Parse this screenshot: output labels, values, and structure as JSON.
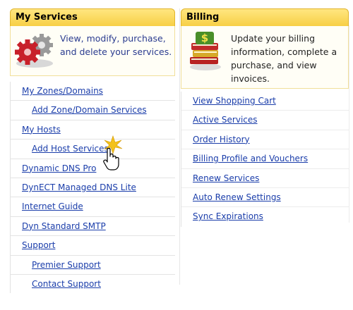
{
  "services": {
    "title": "My Services",
    "intro": "View, modify, purchase, and delete your services.",
    "icon": "gears-icon",
    "items": [
      {
        "label": "My Zones/Domains",
        "indent": false
      },
      {
        "label": "Add Zone/Domain Services",
        "indent": true
      },
      {
        "label": "My Hosts",
        "indent": false
      },
      {
        "label": "Add Host Services",
        "indent": true
      },
      {
        "label": "Dynamic DNS Pro",
        "indent": false
      },
      {
        "label": "DynECT Managed DNS Lite",
        "indent": false
      },
      {
        "label": "Internet Guide",
        "indent": false
      },
      {
        "label": "Dyn Standard SMTP",
        "indent": false
      },
      {
        "label": "Support",
        "indent": false
      },
      {
        "label": "Premier Support",
        "indent": true
      },
      {
        "label": "Contact Support",
        "indent": true
      }
    ]
  },
  "billing": {
    "title": "Billing",
    "intro": "Update your billing information, complete a purchase, and view invoices.",
    "icon": "dollar-books-icon",
    "items": [
      {
        "label": "View Shopping Cart"
      },
      {
        "label": "Active Services"
      },
      {
        "label": "Order History"
      },
      {
        "label": "Billing Profile and Vouchers"
      },
      {
        "label": "Renew Services"
      },
      {
        "label": "Auto Renew Settings"
      },
      {
        "label": "Sync Expirations"
      }
    ]
  },
  "colors": {
    "header_yellow": "#f7cf45",
    "link_blue": "#1a3daa"
  },
  "cursor": {
    "icon": "hand-pointer-icon"
  }
}
